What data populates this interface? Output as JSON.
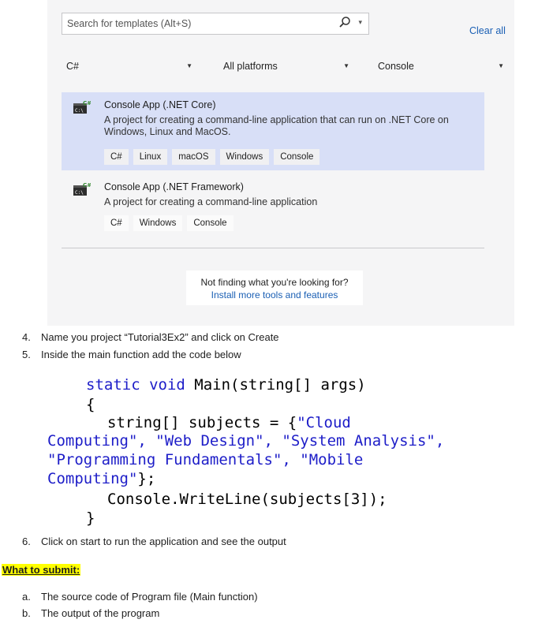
{
  "dialog": {
    "search_placeholder": "Search for templates (Alt+S)",
    "clear_all": "Clear all",
    "filters": {
      "language": "C#",
      "platform": "All platforms",
      "project_type": "Console"
    },
    "templates": [
      {
        "name": "Console App (.NET Core)",
        "description": "A project for creating a command-line application that can run on .NET Core on Windows, Linux and MacOS.",
        "tags": [
          "C#",
          "Linux",
          "macOS",
          "Windows",
          "Console"
        ]
      },
      {
        "name": "Console App (.NET Framework)",
        "description": "A project for creating a command-line application",
        "tags": [
          "C#",
          "Windows",
          "Console"
        ]
      }
    ],
    "not_finding": "Not finding what you're looking for?",
    "install_link": "Install more tools and features"
  },
  "steps": [
    {
      "num": "4.",
      "text": "Name you project “Tutorial3Ex2” and click on Create"
    },
    {
      "num": "5.",
      "text": "Inside the main function add the code below"
    },
    {
      "num": "6.",
      "text": "Click on start to run the application and see the output"
    }
  ],
  "code_lines": [
    "static void Main(string[] args)",
    "{",
    "string[] subjects = {\"Cloud",
    "Computing\", \"Web Design\", \"System Analysis\",",
    "\"Programming Fundamentals\", \"Mobile",
    "Computing\"};",
    "Console.WriteLine(subjects[3]);",
    "}"
  ],
  "submit_heading": "What to submit:",
  "submit_items": [
    {
      "num": "a.",
      "text": "The source code of Program file (Main function)"
    },
    {
      "num": "b.",
      "text": "The output of the program"
    }
  ],
  "colors": {
    "selected_row": "#d8dff7",
    "link": "#1a5fb4",
    "keyword": "#1d1dc8",
    "highlight": "#ffff00"
  }
}
